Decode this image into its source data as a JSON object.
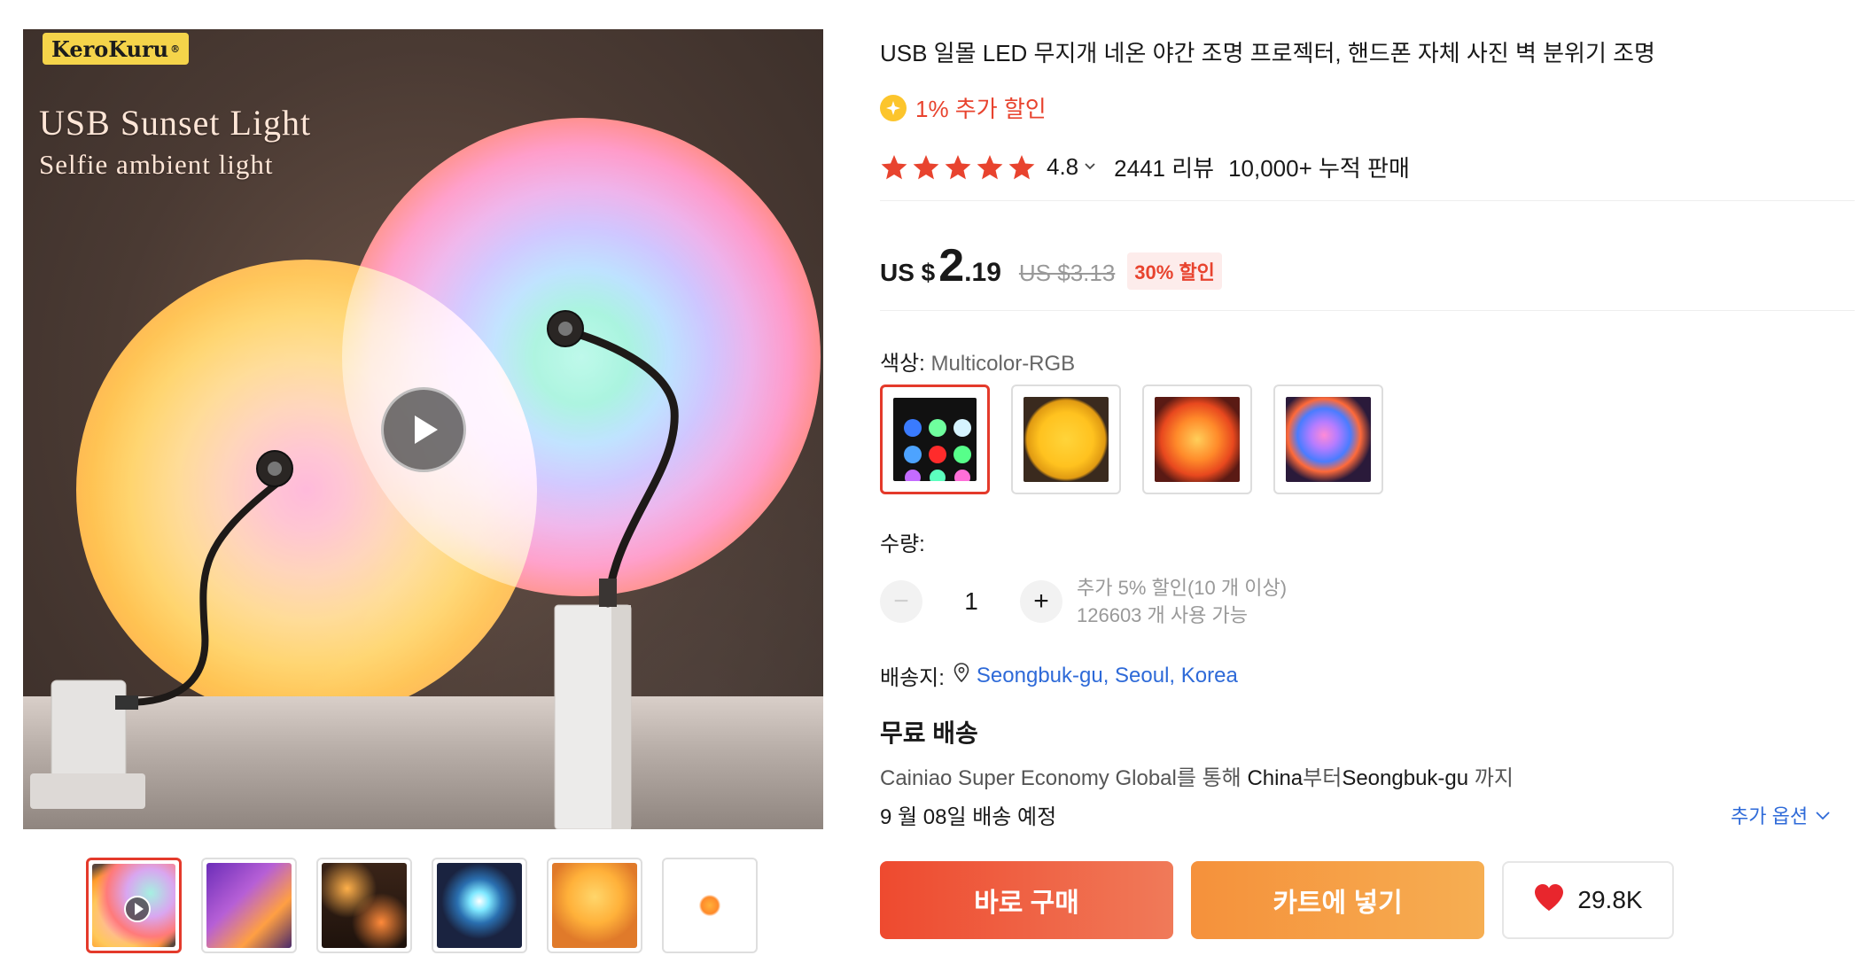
{
  "main_image": {
    "brand": "KeroKuru",
    "brand_mark": "®",
    "headline_line1": "USB Sunset Light",
    "headline_line2": "Selfie ambient light",
    "play_icon": "play-icon"
  },
  "thumbnails": [
    {
      "name": "video-thumbnail",
      "active": true,
      "has_play": true
    },
    {
      "name": "thumbnail-2"
    },
    {
      "name": "thumbnail-3"
    },
    {
      "name": "thumbnail-4"
    },
    {
      "name": "thumbnail-5"
    },
    {
      "name": "thumbnail-6"
    }
  ],
  "product": {
    "title": "USB 일몰 LED 무지개 네온 야간 조명 프로젝터, 핸드폰 자체 사진 벽 분위기 조명",
    "extra_discount": "1% 추가 할인",
    "rating": "4.8",
    "star_count": 5,
    "reviews": "2441 리뷰",
    "sold": "10,000+ 누적 판매"
  },
  "price": {
    "currency": "US $",
    "integer": "2",
    "decimal": ".19",
    "original": "US $3.13",
    "discount": "30% 할인"
  },
  "color": {
    "label": "색상: ",
    "selected": "Multicolor-RGB",
    "swatches": [
      "swatch-multicolor-rgb",
      "swatch-2",
      "swatch-3",
      "swatch-4"
    ]
  },
  "quantity": {
    "label": "수량:",
    "value": "1",
    "minus": "−",
    "plus": "+",
    "bulk_note": "추가 5% 할인(10 개 이상)",
    "available": "126603 개 사용 가능"
  },
  "shipping": {
    "to_label": "배송지:",
    "location": "Seongbuk-gu, Seoul, Korea",
    "free": "무료 배송",
    "method_prefix": "Cainiao Super Economy Global를 통해 ",
    "origin": "China",
    "method_mid": "부터",
    "destination": "Seongbuk-gu",
    "method_suffix": " 까지",
    "estimate": "9 월 08일 배송 예정",
    "more_options": "추가 옵션"
  },
  "actions": {
    "buy_now": "바로 구매",
    "add_to_cart": "카트에 넣기",
    "wishlist_count": "29.8K"
  },
  "colors": {
    "accent_red": "#e8432e",
    "buy_gradient": [
      "#ee4a2f",
      "#f07a59"
    ],
    "cart_gradient": [
      "#f5913b",
      "#f6ae52"
    ],
    "link_blue": "#2e6ad8",
    "star": "#e8432e"
  }
}
